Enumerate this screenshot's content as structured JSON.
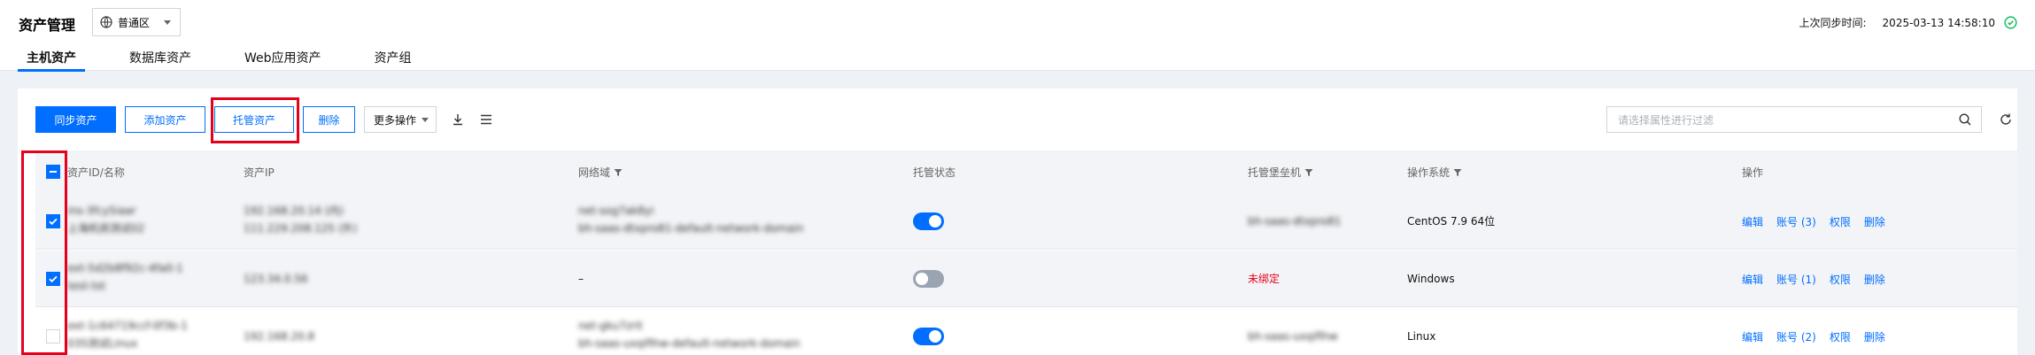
{
  "header": {
    "title": "资产管理",
    "region": "普通区",
    "sync_label": "上次同步时间:",
    "sync_time": "2025-03-13 14:58:10"
  },
  "tabs": [
    "主机资产",
    "数据库资产",
    "Web应用资产",
    "资产组"
  ],
  "toolbar": {
    "sync": "同步资产",
    "add": "添加资产",
    "host": "托管资产",
    "delete": "删除",
    "more": "更多操作"
  },
  "filter": {
    "placeholder": "请选择属性进行过滤"
  },
  "columns": {
    "id_name": "资产ID/名称",
    "ip": "资产IP",
    "network": "网络域",
    "status": "托管状态",
    "bastion": "托管堡垒机",
    "os": "操作系统",
    "ops": "操作"
  },
  "rows": [
    {
      "id": "ins-3fcy5iaar",
      "name": "上海机房测试02",
      "ip1": "192.168.20.14 (内)",
      "ip2": "111.229.208.125 (外)",
      "net1": "net-sog7ak8yi",
      "net2": "bh-saas-dtxpro81-default-network-domain",
      "toggle": "on",
      "bastion": "bh-saas-dtxpro81",
      "os": "CentOS 7.9 64位",
      "account": "账号 (3)",
      "checked": true
    },
    {
      "id": "ext-5d2b8f92c-4fa0-1",
      "name": "test-tst",
      "ip1": "123.34.0.56",
      "ip2": "",
      "net1": "–",
      "net2": "",
      "toggle": "off",
      "bastion": "未绑定",
      "os": "Windows",
      "account": "账号 (1)",
      "checked": true
    },
    {
      "id": "ext-1c64719ccf-0f3b-1",
      "name": "035测试Linux",
      "ip1": "192.168.20.8",
      "ip2": "",
      "net1": "net-gku7zrit",
      "net2": "bh-saas-uxqifihw-default-network-domain",
      "toggle": "on",
      "bastion": "bh-saas-uxqifihw",
      "os": "Linux",
      "account": "账号 (2)",
      "checked": false
    }
  ],
  "row_ops": {
    "edit": "编辑",
    "perm": "权限",
    "delete": "删除"
  },
  "colors": {
    "accent": "#006eff",
    "danger": "#e5001c",
    "success": "#0abf5b"
  }
}
